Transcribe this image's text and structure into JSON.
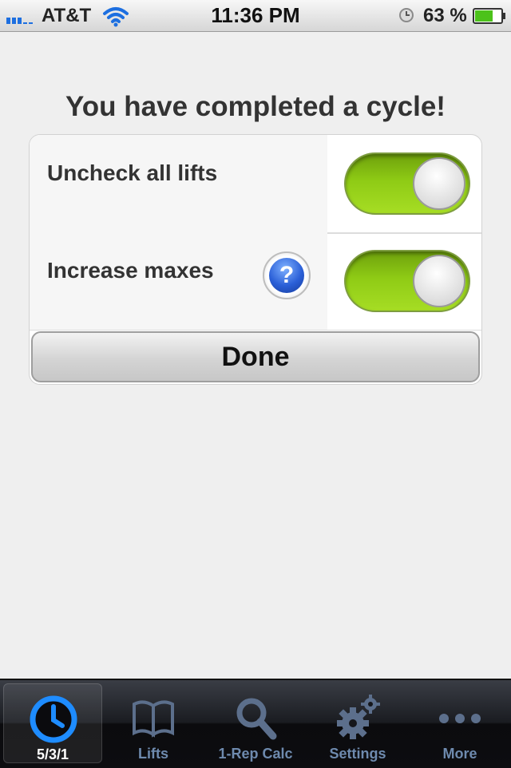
{
  "status_bar": {
    "carrier": "AT&T",
    "time": "11:36 PM",
    "battery_percent": "63 %",
    "icons": [
      "signal-bars-icon",
      "wifi-icon",
      "alarm-clock-icon",
      "battery-icon"
    ]
  },
  "dialog": {
    "heading": "You have completed a cycle!",
    "rows": [
      {
        "label": "Uncheck all lifts",
        "toggle_on": true
      },
      {
        "label": "Increase maxes",
        "toggle_on": true,
        "help_icon": "question-mark-icon",
        "help_text": "?"
      }
    ],
    "done_label": "Done"
  },
  "tab_bar": {
    "active_index": 0,
    "tabs": [
      {
        "label": "5/3/1",
        "icon": "clock-icon"
      },
      {
        "label": "Lifts",
        "icon": "book-icon"
      },
      {
        "label": "1-Rep Calc",
        "icon": "magnifier-icon"
      },
      {
        "label": "Settings",
        "icon": "gears-icon"
      },
      {
        "label": "More",
        "icon": "more-dots-icon"
      }
    ]
  },
  "colors": {
    "toggle_on": "#8fcb15",
    "tab_active_icon": "#1e8cff",
    "tab_inactive": "#6e8aae",
    "background": "#efefef"
  }
}
